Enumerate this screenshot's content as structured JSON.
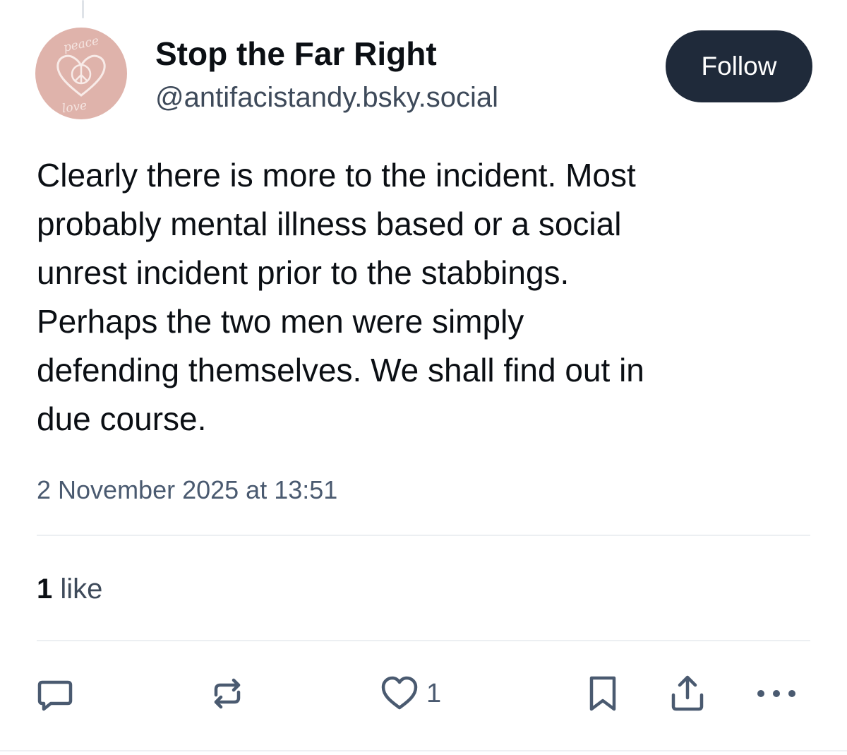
{
  "author": {
    "display_name": "Stop the Far Right",
    "handle": "@antifacistandy.bsky.social",
    "avatar_text_top": "peace",
    "avatar_text_bottom": "love"
  },
  "follow_button": {
    "label": "Follow"
  },
  "post": {
    "lines": [
      "Clearly there is more to the incident. Most",
      "probably mental illness based or a social",
      "unrest incident prior to the stabbings.",
      "Perhaps the two men were simply",
      "defending themselves. We shall find out in",
      "due course."
    ],
    "timestamp": "2 November 2025 at 13:51"
  },
  "stats": {
    "like_count": "1",
    "like_label": "like"
  },
  "actions": {
    "reply_icon": "speech-bubble-icon",
    "repost_icon": "repost-arrows-icon",
    "like_icon": "heart-icon",
    "like_count": "1",
    "bookmark_icon": "bookmark-icon",
    "share_icon": "share-upload-icon",
    "more_icon": "ellipsis-icon"
  },
  "colors": {
    "follow_bg": "#1f2a3a",
    "icon_gray": "#4a5a70",
    "avatar_pink": "#dfb3ab"
  }
}
